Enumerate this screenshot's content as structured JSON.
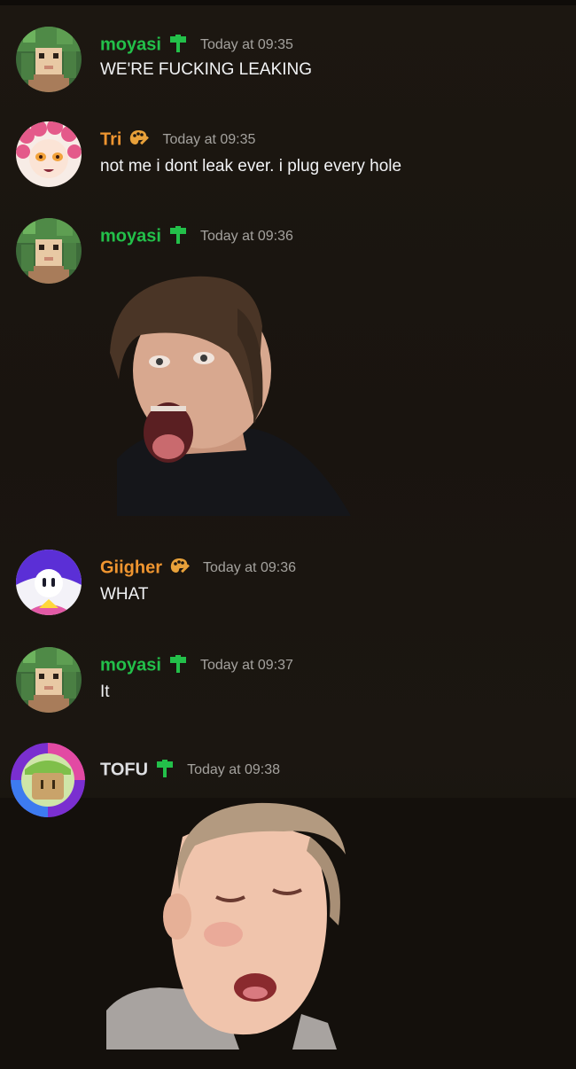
{
  "messages": [
    {
      "username": "moyasi",
      "badge": "hammer-icon",
      "timestamp": "Today at 09:35",
      "text": "WE'RE FUCKING LEAKING",
      "name_color": "#23c04a"
    },
    {
      "username": "Tri",
      "badge": "palette-icon",
      "timestamp": "Today at 09:35",
      "text": "not me i dont leak ever. i plug every hole",
      "name_color": "#ef9530"
    },
    {
      "username": "moyasi",
      "badge": "hammer-icon",
      "timestamp": "Today at 09:36",
      "attachment": "sticker-shocked-man",
      "name_color": "#23c04a"
    },
    {
      "username": "Giigher",
      "badge": "palette-icon",
      "timestamp": "Today at 09:36",
      "text": "WHAT",
      "name_color": "#ef9530"
    },
    {
      "username": "moyasi",
      "badge": "hammer-icon",
      "timestamp": "Today at 09:37",
      "text": "It",
      "name_color": "#23c04a"
    },
    {
      "username": "TOFU",
      "badge": "hammer-icon",
      "timestamp": "Today at 09:38",
      "attachment": "sticker-sleepy-man",
      "name_color": "#dedfe2"
    }
  ],
  "colors": {
    "background": "#1a1510",
    "timestamp": "#a4a29e",
    "message_text": "#f2f3f5",
    "hammer_badge": "#23c04a",
    "palette_badge": "#e8a13a"
  }
}
